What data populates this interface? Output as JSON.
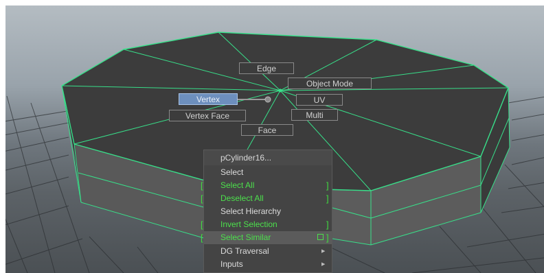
{
  "marking_menu": {
    "edge": "Edge",
    "object_mode": "Object Mode",
    "vertex": "Vertex",
    "uv": "UV",
    "vertex_face": "Vertex Face",
    "multi": "Multi",
    "face": "Face"
  },
  "context_menu": {
    "title": "pCylinder16...",
    "items": [
      {
        "label": "Select",
        "style": "normal"
      },
      {
        "label": "Select All",
        "style": "green"
      },
      {
        "label": "Deselect All",
        "style": "green"
      },
      {
        "label": "Select Hierarchy",
        "style": "normal"
      },
      {
        "label": "Invert Selection",
        "style": "green"
      },
      {
        "label": "Select Similar",
        "style": "green",
        "option_box": true
      },
      {
        "label": "DG Traversal",
        "style": "normal",
        "submenu": true
      },
      {
        "label": "Inputs",
        "style": "normal",
        "submenu": true
      }
    ]
  },
  "colors": {
    "wireframe": "#38e08a",
    "active_mode": "#6d8fbd",
    "menu_green": "#4ce04c"
  },
  "icons": [
    "submenu-arrow-icon",
    "option-box-icon"
  ]
}
